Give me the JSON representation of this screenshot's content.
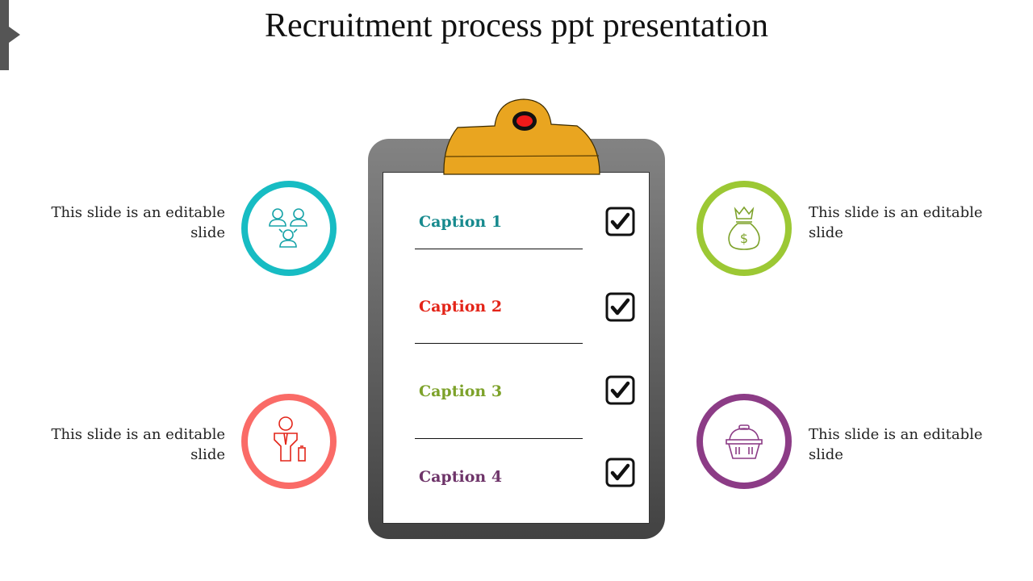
{
  "title": "Recruitment process ppt presentation",
  "side_items": [
    {
      "text_line1": "This slide is an editable",
      "text_line2": "slide",
      "icon": "people-network-icon",
      "color": "#17BCC3"
    },
    {
      "text_line1": "This slide is an editable",
      "text_line2": "slide",
      "icon": "businessman-icon",
      "color": "#FA6B67"
    },
    {
      "text_line1": "This slide is an editable",
      "text_line2": "slide",
      "icon": "money-bag-icon",
      "color": "#9CC834"
    },
    {
      "text_line1": "This slide is an editable",
      "text_line2": "slide",
      "icon": "basket-icon",
      "color": "#8C3C86"
    }
  ],
  "checklist": [
    {
      "label": "Caption 1",
      "color": "#178A8E",
      "checked": true
    },
    {
      "label": "Caption 2",
      "color": "#E32418",
      "checked": true
    },
    {
      "label": "Caption 3",
      "color": "#7DA22A",
      "checked": true
    },
    {
      "label": "Caption 4",
      "color": "#6E3469",
      "checked": true
    }
  ],
  "colors": {
    "clip": "#E9A520",
    "clip_dot": "#F01A1A",
    "board_top": "#838383",
    "board_bottom": "#424242"
  }
}
